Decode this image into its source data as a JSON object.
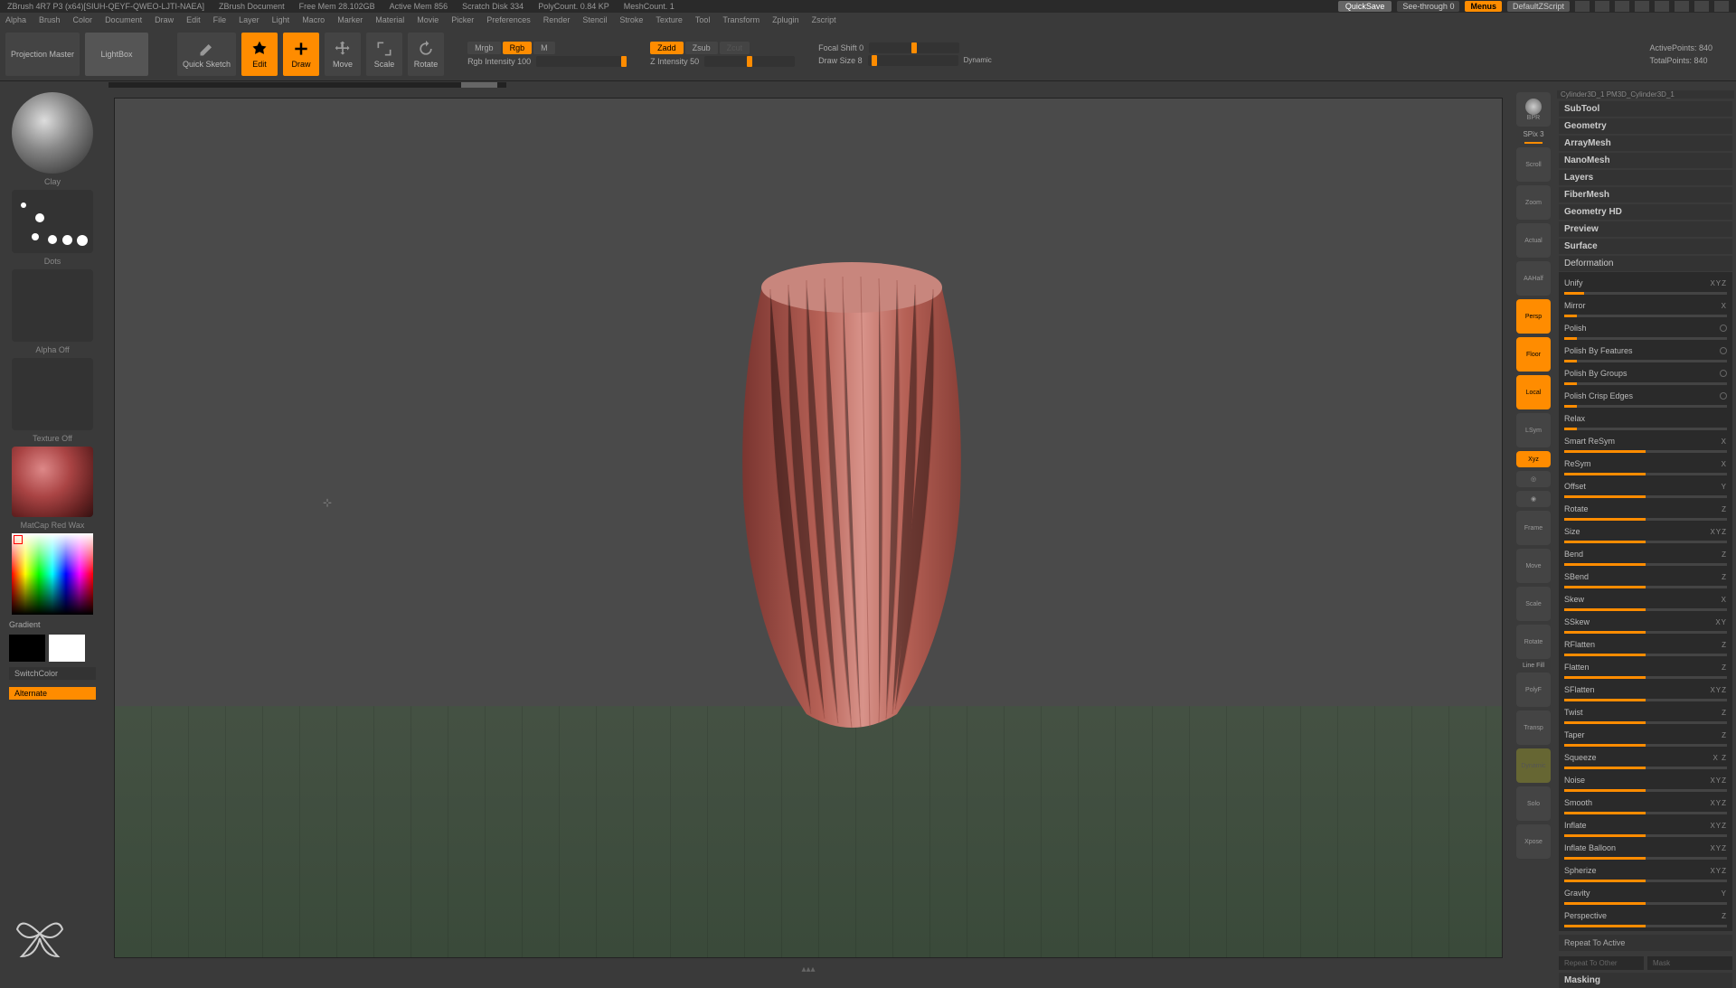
{
  "titlebar": {
    "app": "ZBrush 4R7 P3 (x64)[SIUH-QEYF-QWEO-LJTI-NAEA]",
    "doc": "ZBrush Document",
    "freemem": "Free Mem 28.102GB",
    "activemem": "Active Mem 856",
    "scratch": "Scratch Disk 334",
    "polycount": "PolyCount. 0.84 KP",
    "meshcount": "MeshCount. 1",
    "quicksave": "QuickSave",
    "seethrough": "See-through   0",
    "menus": "Menus",
    "defaultscript": "DefaultZScript"
  },
  "menubar": [
    "Alpha",
    "Brush",
    "Color",
    "Document",
    "Draw",
    "Edit",
    "File",
    "Layer",
    "Light",
    "Macro",
    "Marker",
    "Material",
    "Movie",
    "Picker",
    "Preferences",
    "Render",
    "Stencil",
    "Stroke",
    "Texture",
    "Tool",
    "Transform",
    "Zplugin",
    "Zscript"
  ],
  "toolbar": {
    "projection": "Projection Master",
    "lightbox": "LightBox",
    "quicksketch": "Quick Sketch",
    "edit": "Edit",
    "draw": "Draw",
    "move": "Move",
    "scale": "Scale",
    "rotate": "Rotate",
    "mrgb": "Mrgb",
    "rgb": "Rgb",
    "m": "M",
    "rgbintensity": "Rgb Intensity 100",
    "zadd": "Zadd",
    "zsub": "Zsub",
    "zcut": "Zcut",
    "zintensity": "Z Intensity 50",
    "focalshift": "Focal Shift 0",
    "drawsize": "Draw Size 8",
    "dynamic": "Dynamic",
    "activepoints": "ActivePoints: 840",
    "totalpoints": "TotalPoints: 840"
  },
  "left": {
    "brush": "Clay",
    "stroke": "Dots",
    "alpha": "Alpha  Off",
    "texture": "Texture  Off",
    "material": "MatCap Red Wax",
    "gradient": "Gradient",
    "switchcolor": "SwitchColor",
    "alternate": "Alternate"
  },
  "sidenav": {
    "bpr": "BPR",
    "spix": "SPix 3",
    "items": [
      "Scroll",
      "Zoom",
      "Actual",
      "AAHalf",
      "Persp",
      "Floor",
      "Local",
      "LSym",
      "Xyz",
      "",
      "",
      "Frame",
      "Move",
      "Scale",
      "Rotate",
      "Line Fill",
      "PolyF",
      "Transp",
      "Dynamic",
      "Solo",
      "Xpose"
    ]
  },
  "right": {
    "toolthumb": "Cylinder3D_1      PM3D_Cylinder3D_1",
    "sections": [
      "SubTool",
      "Geometry",
      "ArrayMesh",
      "NanoMesh",
      "Layers",
      "FiberMesh",
      "Geometry HD",
      "Preview",
      "Surface"
    ],
    "deformation": "Deformation",
    "defs": [
      {
        "name": "Unify",
        "axis": "XYZ"
      },
      {
        "name": "Mirror",
        "axis": "X"
      },
      {
        "name": "Polish",
        "dot": true
      },
      {
        "name": "Polish By Features",
        "dot": true
      },
      {
        "name": "Polish By Groups",
        "dot": true
      },
      {
        "name": "Polish Crisp Edges",
        "dot": true
      },
      {
        "name": "Relax",
        "axis": ""
      },
      {
        "name": "Smart ReSym",
        "axis": "X"
      },
      {
        "name": "ReSym",
        "axis": "X"
      },
      {
        "name": "Offset",
        "axis": "Y"
      },
      {
        "name": "Rotate",
        "axis": "Z"
      },
      {
        "name": "Size",
        "axis": "XYZ"
      },
      {
        "name": "Bend",
        "axis": "Z"
      },
      {
        "name": "SBend",
        "axis": "Z"
      },
      {
        "name": "Skew",
        "axis": "X"
      },
      {
        "name": "SSkew",
        "axis": "XY"
      },
      {
        "name": "RFlatten",
        "axis": "Z"
      },
      {
        "name": "Flatten",
        "axis": "Z"
      },
      {
        "name": "SFlatten",
        "axis": "XYZ"
      },
      {
        "name": "Twist",
        "axis": "Z"
      },
      {
        "name": "Taper",
        "axis": "Z"
      },
      {
        "name": "Squeeze",
        "axis": "X  Z"
      },
      {
        "name": "Noise",
        "axis": "XYZ"
      },
      {
        "name": "Smooth",
        "axis": "XYZ"
      },
      {
        "name": "Inflate",
        "axis": "XYZ"
      },
      {
        "name": "Inflate Balloon",
        "axis": "XYZ"
      },
      {
        "name": "Spherize",
        "axis": "XYZ"
      },
      {
        "name": "Gravity",
        "axis": "Y"
      },
      {
        "name": "Perspective",
        "axis": "Z"
      }
    ],
    "repeat_active": "Repeat To Active",
    "repeat_other": "Repeat To Other",
    "mask": "Mask",
    "masking": "Masking"
  }
}
